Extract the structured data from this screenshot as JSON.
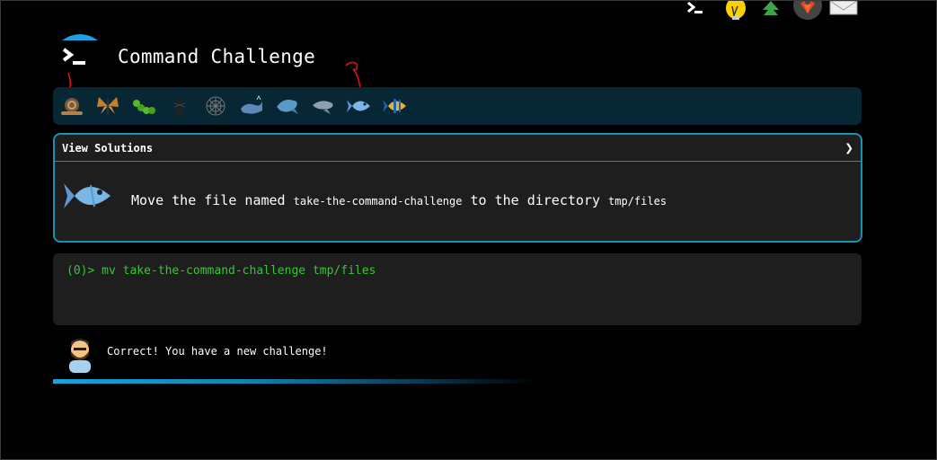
{
  "header": {
    "title": "Command Challenge",
    "top_icons": [
      "terminal-icon",
      "lightbulb-icon",
      "tree-icon",
      "gitlab-icon",
      "mail-icon"
    ]
  },
  "levels": {
    "items": [
      "snail",
      "butterfly",
      "caterpillar",
      "ant",
      "spider-web",
      "whale",
      "dolphin",
      "dolphin-2",
      "fish",
      "tropical-fish"
    ],
    "active": "fish"
  },
  "challenge": {
    "header_label": "View Solutions",
    "text_prefix": "Move the file named ",
    "filename": "take-the-command-challenge",
    "text_middle": " to the directory ",
    "directory": "tmp/files"
  },
  "terminal": {
    "prompt_count": "(0)> ",
    "command": "mv take-the-command-challenge tmp/files"
  },
  "feedback": {
    "message": "Correct! You have a new challenge!"
  },
  "colors": {
    "accent": "#1a8fb5",
    "level_bar": "#062733",
    "prompt_green": "#39c43a",
    "panel": "#1e1e1e"
  },
  "progress": {
    "fraction": 0.6
  }
}
